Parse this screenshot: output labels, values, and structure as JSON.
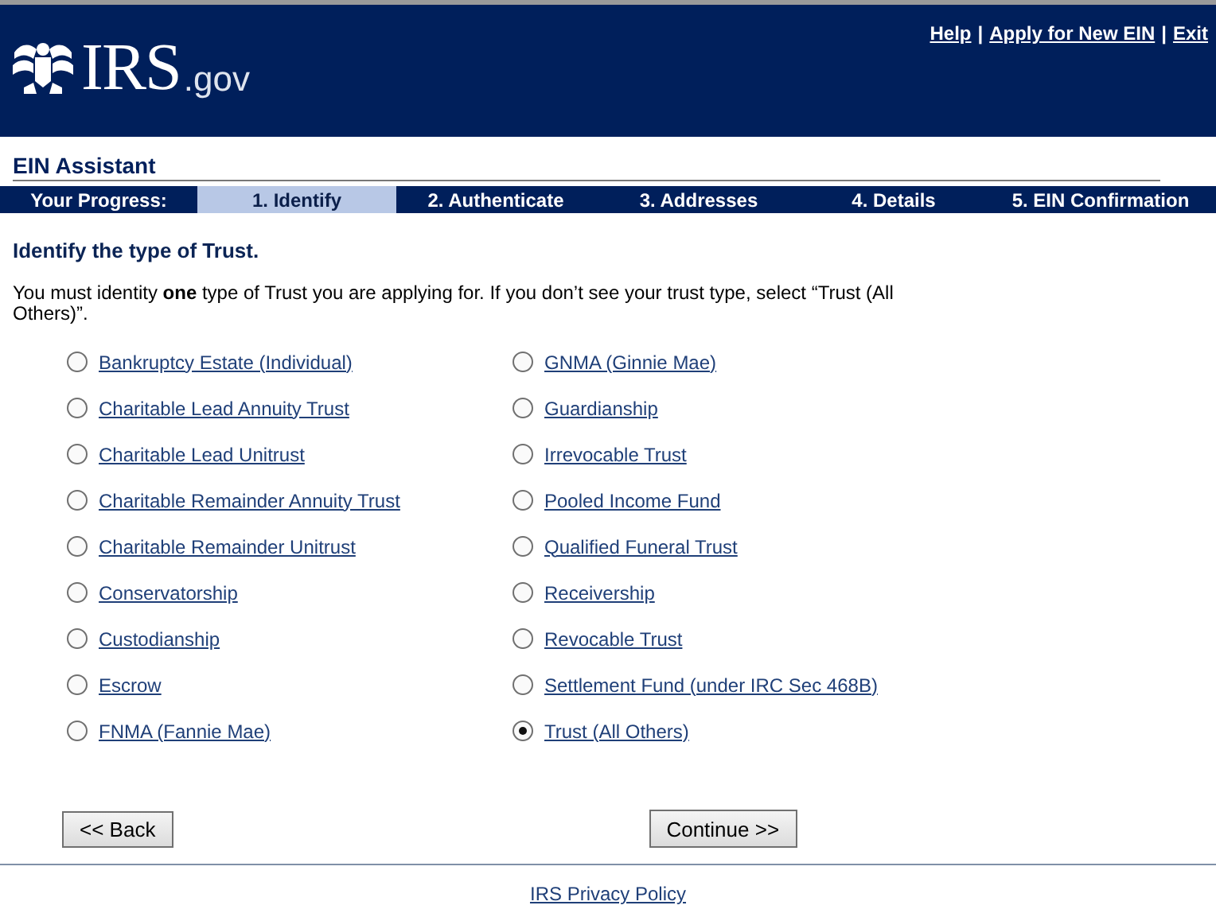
{
  "header": {
    "logo_text": "IRS",
    "logo_suffix": ".gov",
    "links": [
      "Help",
      "Apply for New EIN",
      "Exit"
    ],
    "separator": "|"
  },
  "title": "EIN Assistant",
  "progress": {
    "label": "Your Progress:",
    "steps": [
      {
        "label": "1. Identify",
        "selected": true
      },
      {
        "label": "2. Authenticate",
        "selected": false
      },
      {
        "label": "3. Addresses",
        "selected": false
      },
      {
        "label": "4. Details",
        "selected": false
      },
      {
        "label": "5. EIN Confirmation",
        "selected": false
      }
    ]
  },
  "heading": "Identify the type of Trust.",
  "instruction": "You must identity **one** type of Trust you are applying for. If you don’t see your trust type, select “Trust (All Others)”.",
  "options": [
    {
      "label": "Bankruptcy Estate (Individual)",
      "selected": false
    },
    {
      "label": "Charitable Lead Annuity Trust",
      "selected": false
    },
    {
      "label": "Charitable Lead Unitrust",
      "selected": false
    },
    {
      "label": "Charitable Remainder Annuity Trust",
      "selected": false
    },
    {
      "label": "Charitable Remainder Unitrust",
      "selected": false
    },
    {
      "label": "Conservatorship",
      "selected": false
    },
    {
      "label": "Custodianship",
      "selected": false
    },
    {
      "label": "Escrow",
      "selected": false
    },
    {
      "label": "FNMA (Fannie Mae)",
      "selected": false
    },
    {
      "label": "GNMA (Ginnie Mae)",
      "selected": false
    },
    {
      "label": "Guardianship",
      "selected": false
    },
    {
      "label": "Irrevocable Trust",
      "selected": false
    },
    {
      "label": "Pooled Income Fund",
      "selected": false
    },
    {
      "label": "Qualified Funeral Trust",
      "selected": false
    },
    {
      "label": "Receivership",
      "selected": false
    },
    {
      "label": "Revocable Trust",
      "selected": false
    },
    {
      "label": "Settlement Fund (under IRC Sec 468B)",
      "selected": false
    },
    {
      "label": "Trust (All Others)",
      "selected": true
    }
  ],
  "buttons": {
    "back": "<< Back",
    "continue": "Continue >>"
  },
  "footer_link": "IRS Privacy Policy"
}
